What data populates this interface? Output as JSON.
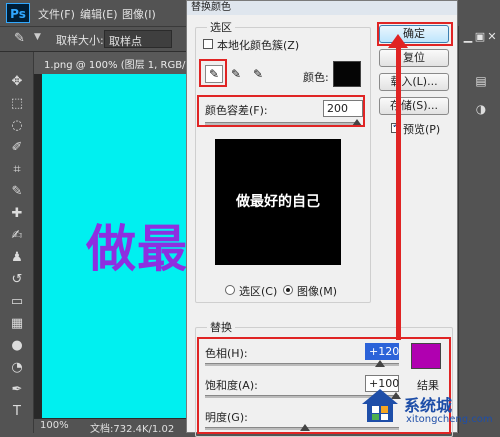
{
  "app": {
    "logo": "Ps"
  },
  "menu": {
    "items": [
      "文件(F)",
      "编辑(E)",
      "图像(I)"
    ]
  },
  "options_bar": {
    "tool_icon": "eyedropper-icon",
    "sample_size_label": "取样大小:",
    "sample_size_value": "取样点"
  },
  "document": {
    "tab_title": "1.png @ 100% (图层 1, RGB/8) *",
    "canvas_text": "做最",
    "canvas_color": "#00f0f0",
    "text_color": "#8e2fe0"
  },
  "status_bar": {
    "zoom": "100%",
    "doc_info": "文档:732.4K/1.02"
  },
  "dialog": {
    "title": "替换颜色",
    "selection": {
      "group_label": "选区",
      "localized_clusters_label": "本地化颜色簇(Z)",
      "localized_clusters_checked": false,
      "color_label": "颜色:",
      "color_swatch": "#050505",
      "fuzziness_label": "颜色容差(F):",
      "fuzziness_value": "200",
      "fuzziness_level": 1.0,
      "preview_text": "做最好的自己",
      "radio_selection_label": "选区(C)",
      "radio_image_label": "图像(M)",
      "selected_mode": "image"
    },
    "replace": {
      "group_label": "替换",
      "hue_label": "色相(H):",
      "hue_value": "+120",
      "saturation_label": "饱和度(A):",
      "saturation_value": "+100",
      "lightness_label": "明度(G):",
      "result_color": "#b000b0",
      "result_label": "结果"
    },
    "buttons": {
      "ok": "确定",
      "reset": "复位",
      "load": "载入(L)...",
      "save": "存储(S)...",
      "preview": "预览(P)",
      "preview_checked": true
    }
  },
  "annotation": {
    "highlight_color": "#e02424"
  },
  "watermark": {
    "text": "系统城",
    "url": "xitongcheng.com"
  }
}
